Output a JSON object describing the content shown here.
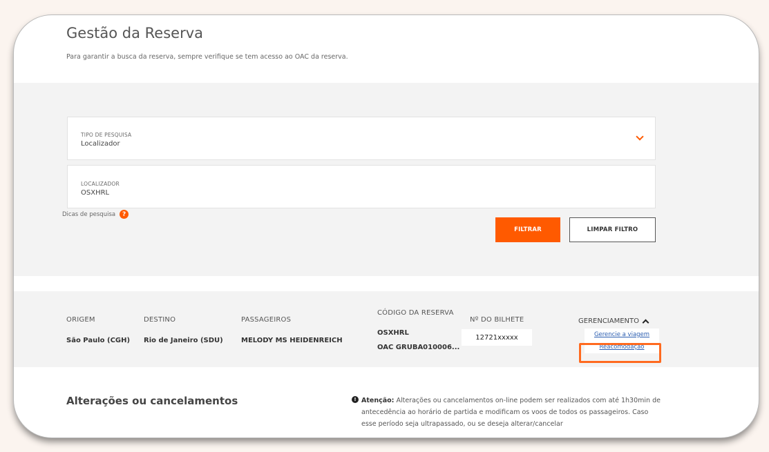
{
  "header": {
    "title": "Gestão da Reserva",
    "subtitle": "Para garantir a busca da reserva, sempre verifique se tem acesso ao OAC da reserva."
  },
  "filters": {
    "search_type": {
      "label": "TIPO DE PESQUISA",
      "value": "Localizador"
    },
    "locator": {
      "label": "LOCALIZADOR",
      "value": "OSXHRL"
    },
    "tips_label": "Dicas de pesquisa",
    "help_glyph": "?",
    "filter_button": "FILTRAR",
    "clear_button": "LIMPAR FILTRO"
  },
  "results": {
    "columns": {
      "origin": "ORIGEM",
      "destination": "DESTINO",
      "passengers": "PASSAGEIROS",
      "booking_code": "CÓDIGO DA RESERVA",
      "ticket_number": "Nº DO BILHETE"
    },
    "row": {
      "origin": "São Paulo (CGH)",
      "destination": "Rio de Janeiro (SDU)",
      "passengers": "MELODY MS HEIDENREICH",
      "booking_code": "OSXHRL",
      "oac": "OAC GRUBA010006...",
      "ticket_number": "12721xxxxx"
    },
    "management": {
      "label": "GERENCIAMENTO",
      "items": [
        "Gerencie a viagem",
        "Reacomodação"
      ]
    }
  },
  "changes": {
    "title": "Alterações ou cancelamentos",
    "notice_glyph": "!",
    "notice_bold": "Atenção:",
    "notice_text": "Alterações ou cancelamentos on-line podem ser realizados com até 1h30min de antecedência ao horário de partida e modificam os voos de todos os passageiros. Caso esse período seja ultrapassado, ou se deseja alterar/cancelar"
  },
  "colors": {
    "accent": "#ff5a00",
    "highlight": "#ff6a1f",
    "link": "#2a5db0",
    "panel": "#f3f3f3"
  },
  "icons": {
    "search_type_dropdown": "chevron-down-icon",
    "tips": "help-icon",
    "management": "chevron-up-icon",
    "notice": "info-icon"
  }
}
